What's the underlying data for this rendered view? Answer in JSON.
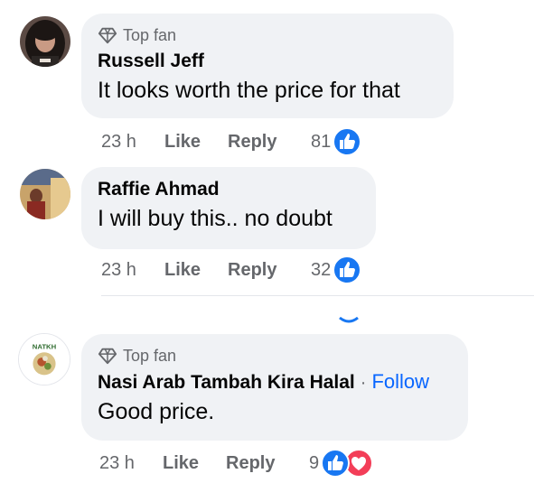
{
  "comments": [
    {
      "badge": "Top fan",
      "author": "Russell Jeff",
      "text": "It looks worth the price for that",
      "time": "23 h",
      "like_label": "Like",
      "reply_label": "Reply",
      "reaction_count": "81",
      "reactions": [
        "like-icon"
      ]
    },
    {
      "author": "Raffie Ahmad",
      "text": "I will buy this.. no doubt",
      "time": "23 h",
      "like_label": "Like",
      "reply_label": "Reply",
      "reaction_count": "32",
      "reactions": [
        "like-icon"
      ]
    },
    {
      "badge": "Top fan",
      "author": "Nasi Arab Tambah Kira Halal",
      "separator": "·",
      "follow_label": "Follow",
      "text": "Good price.",
      "time": "23 h",
      "like_label": "Like",
      "reply_label": "Reply",
      "reaction_count": "9",
      "reactions": [
        "like-icon",
        "love-icon"
      ]
    }
  ],
  "colors": {
    "bubble": "#f0f2f5",
    "meta_text": "#65676b",
    "link_blue": "#0866ff",
    "like_blue": "#1877f2",
    "love_red": "#f33e58"
  },
  "avatars": {
    "third_logo_text": "NATKH"
  }
}
